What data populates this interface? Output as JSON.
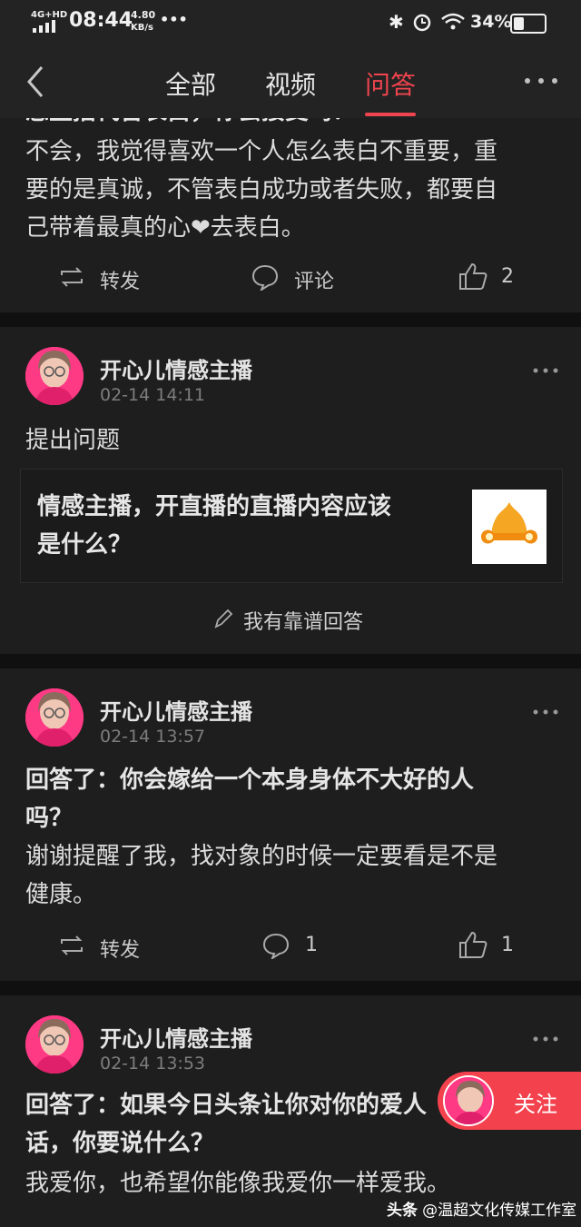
{
  "status_bar": {
    "network": "4G+HD",
    "time": "08:44",
    "speed_value": "4.80",
    "speed_unit": "KB/s",
    "dots": "•••",
    "battery": "34%",
    "battery_level": 0.34
  },
  "nav": {
    "tabs": [
      "全部",
      "视频",
      "问答"
    ],
    "active_tab": "问答"
  },
  "post0": {
    "cut_line": "您主播代替表白，你会接受吗？",
    "lines": [
      "不会，我觉得喜欢一个人怎么表白不重要，重",
      "要的是真诚，不管表白成功或者失败，都要自",
      "己带着最真的心❤去表白。"
    ],
    "repost": "转发",
    "comment": "评论",
    "likes": "2"
  },
  "post1": {
    "name": "开心儿情感主播",
    "time": "02-14 14:11",
    "text": "提出问题",
    "question_lines": [
      "情感主播，开直播的直播内容应该",
      "是什么？"
    ],
    "answer_button": "我有靠谱回答"
  },
  "post2": {
    "name": "开心儿情感主播",
    "time": "02-14 13:57",
    "title_lines": [
      "回答了：你会嫁给一个本身身体不大好的人",
      "吗？"
    ],
    "body_lines": [
      "谢谢提醒了我，找对象的时候一定要看是不是",
      "健康。"
    ],
    "repost": "转发",
    "comments": "1",
    "likes": "1"
  },
  "post3": {
    "name": "开心儿情感主播",
    "time": "02-14 13:53",
    "title_lines": [
      "回答了：如果今日头条让你对你的爱人",
      "话，你要说什么？"
    ],
    "body": "我爱你，也希望你能像我爱你一样爱我。"
  },
  "follow": {
    "label": "关注"
  },
  "watermark": {
    "app": "头条",
    "account": "@温超文化传媒工作室"
  },
  "colors": {
    "accent": "#f0444e",
    "background": "#151515",
    "card": "#1e1e1e"
  }
}
